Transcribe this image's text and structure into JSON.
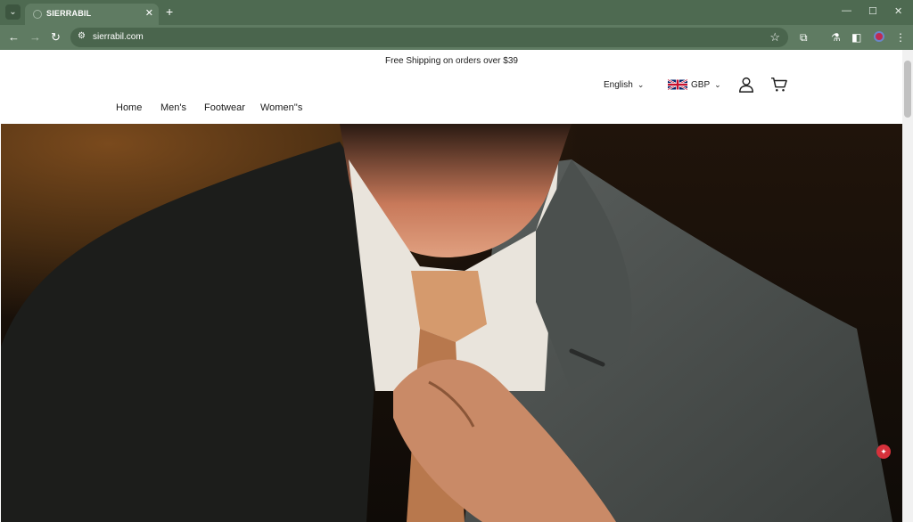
{
  "browser": {
    "tab_title": "SIERRABIL",
    "url": "sierrabil.com",
    "tab_list_icon": "chevron-down-icon",
    "new_tab_icon": "plus-icon",
    "accent_color": "#4e6a51"
  },
  "page": {
    "announcement": "Free Shipping on orders over $39",
    "language": "English",
    "currency": "GBP",
    "currency_flag": "uk-flag-icon",
    "nav": [
      "Home",
      "Men's",
      "Footwear",
      "Women''s"
    ],
    "hero_image": "man-in-suit-adjusting-tie"
  }
}
